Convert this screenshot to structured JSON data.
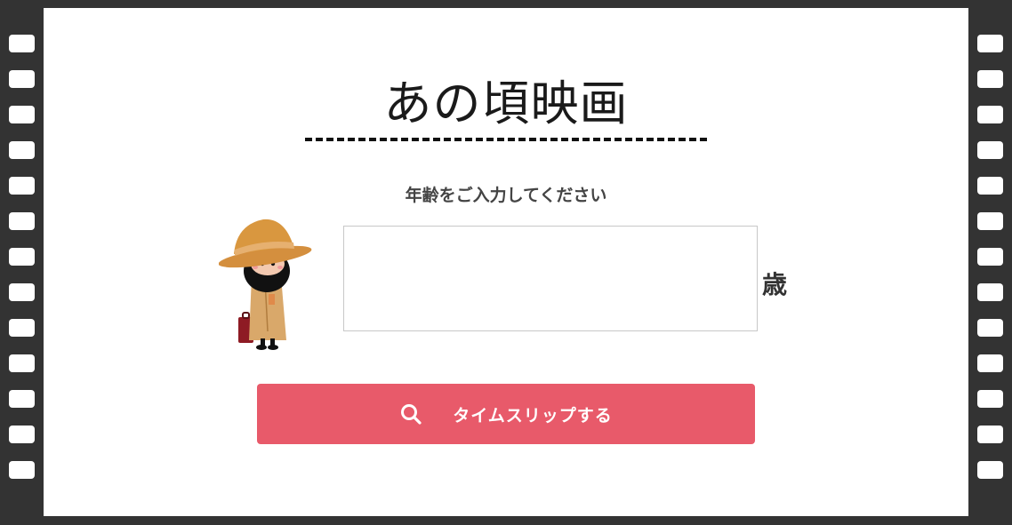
{
  "app": {
    "title": "あの頃映画"
  },
  "form": {
    "prompt": "年齢をご入力してください",
    "age_value": "",
    "age_placeholder": "",
    "age_unit": "歳",
    "submit_label": "タイムスリップする",
    "submit_icon": "search-icon"
  },
  "colors": {
    "background_frame": "#333333",
    "panel": "#ffffff",
    "accent_button": "#e85a6a",
    "text": "#333333"
  }
}
